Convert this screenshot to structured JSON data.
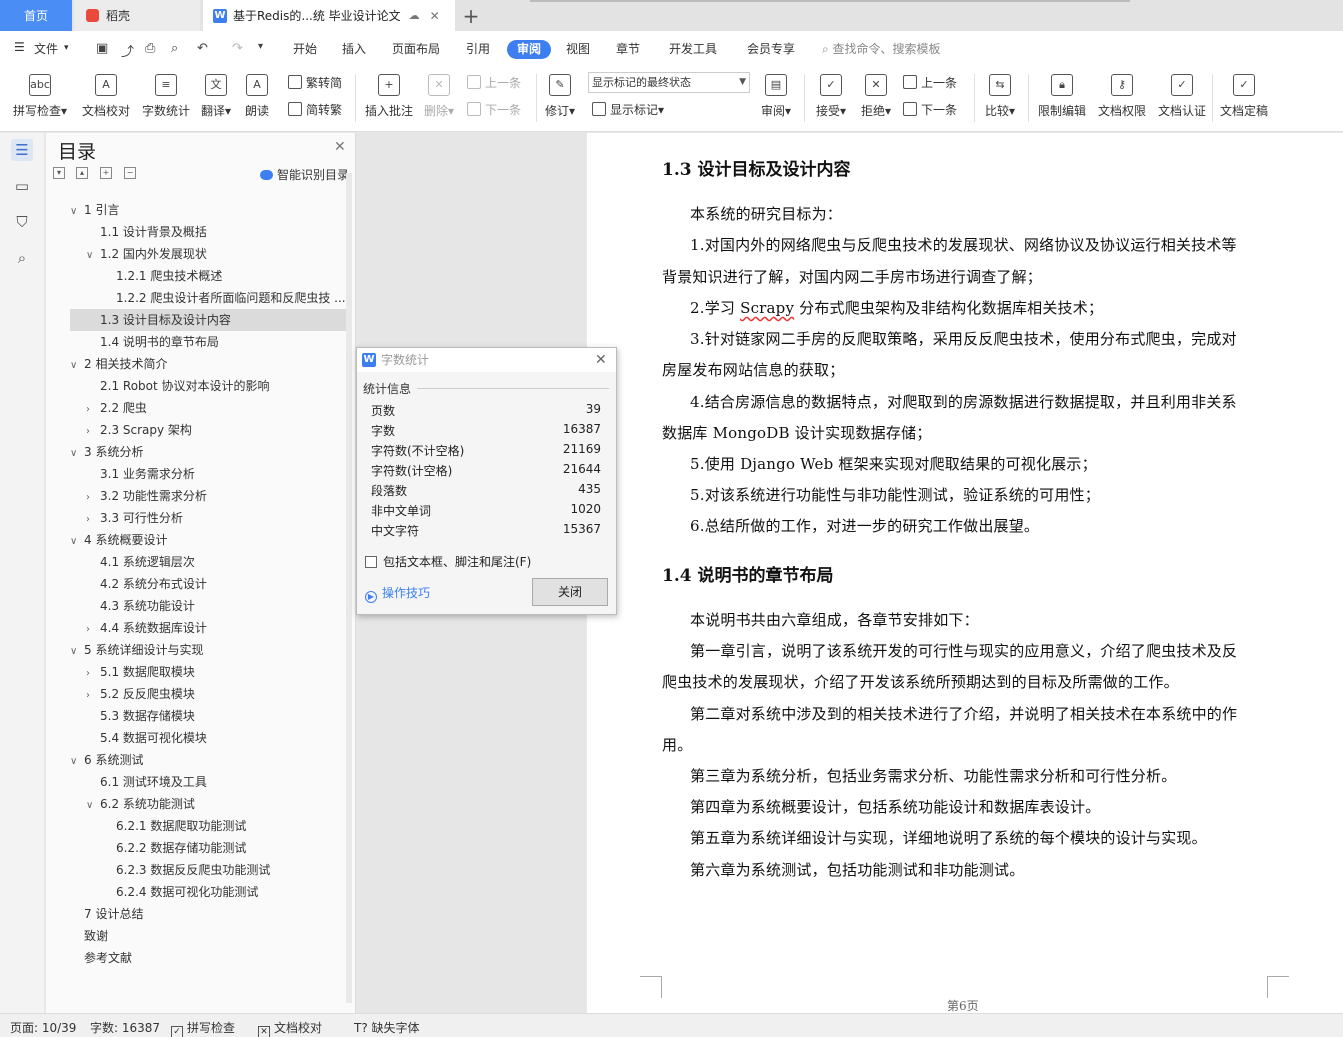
{
  "tabs": {
    "home": "首页",
    "daoke": "稻壳",
    "doc": "基于Redis的...统 毕业设计论文",
    "add": "+"
  },
  "menu": {
    "file": "文件",
    "items": [
      "开始",
      "插入",
      "页面布局",
      "引用",
      "审阅",
      "视图",
      "章节",
      "开发工具",
      "会员专享"
    ],
    "active": "审阅",
    "search": "查找命令、搜索模板"
  },
  "ribbon": {
    "spell": "拼写检查",
    "proof": "文档校对",
    "wordcount": "字数统计",
    "translate": "翻译",
    "read": "朗读",
    "trad": "繁转简",
    "simp": "简转繁",
    "insert_comment": "插入批注",
    "delete": "删除",
    "prev1": "上一条",
    "next1": "下一条",
    "revise": "修订",
    "mark_state": "显示标记的最终状态",
    "show_marks": "显示标记",
    "review": "审阅",
    "accept": "接受",
    "reject": "拒绝",
    "prev2": "上一条",
    "next2": "下一条",
    "compare": "比较",
    "restrict": "限制编辑",
    "perm": "文档权限",
    "cert": "文档认证",
    "final": "文档定稿"
  },
  "toc": {
    "title": "目录",
    "ai_label": "智能识别目录",
    "items": [
      {
        "text": "1  引言",
        "level": 0,
        "arrow": "down"
      },
      {
        "text": "1.1  设计背景及概括",
        "level": 1,
        "arrow": ""
      },
      {
        "text": "1.2  国内外发展现状",
        "level": 1,
        "arrow": "down"
      },
      {
        "text": "1.2.1  爬虫技术概述",
        "level": 2,
        "arrow": ""
      },
      {
        "text": "1.2.2  爬虫设计者所面临问题和反爬虫技 ...",
        "level": 2,
        "arrow": ""
      },
      {
        "text": "1.3  设计目标及设计内容",
        "level": 1,
        "arrow": "",
        "selected": true
      },
      {
        "text": "1.4  说明书的章节布局",
        "level": 1,
        "arrow": ""
      },
      {
        "text": "2  相关技术简介",
        "level": 0,
        "arrow": "down"
      },
      {
        "text": "2.1 Robot 协议对本设计的影响",
        "level": 1,
        "arrow": ""
      },
      {
        "text": "2.2  爬虫",
        "level": 1,
        "arrow": "right"
      },
      {
        "text": "2.3 Scrapy 架构",
        "level": 1,
        "arrow": "right"
      },
      {
        "text": "3  系统分析",
        "level": 0,
        "arrow": "down"
      },
      {
        "text": "3.1  业务需求分析",
        "level": 1,
        "arrow": ""
      },
      {
        "text": "3.2  功能性需求分析",
        "level": 1,
        "arrow": "right"
      },
      {
        "text": "3.3  可行性分析",
        "level": 1,
        "arrow": "right"
      },
      {
        "text": "4  系统概要设计",
        "level": 0,
        "arrow": "down"
      },
      {
        "text": "4.1  系统逻辑层次",
        "level": 1,
        "arrow": ""
      },
      {
        "text": "4.2  系统分布式设计",
        "level": 1,
        "arrow": ""
      },
      {
        "text": "4.3  系统功能设计",
        "level": 1,
        "arrow": ""
      },
      {
        "text": "4.4  系统数据库设计",
        "level": 1,
        "arrow": "right"
      },
      {
        "text": "5  系统详细设计与实现",
        "level": 0,
        "arrow": "down"
      },
      {
        "text": "5.1  数据爬取模块",
        "level": 1,
        "arrow": "right"
      },
      {
        "text": "5.2  反反爬虫模块",
        "level": 1,
        "arrow": "right"
      },
      {
        "text": "5.3  数据存储模块",
        "level": 1,
        "arrow": ""
      },
      {
        "text": "5.4  数据可视化模块",
        "level": 1,
        "arrow": ""
      },
      {
        "text": "6  系统测试",
        "level": 0,
        "arrow": "down"
      },
      {
        "text": "6.1  测试环境及工具",
        "level": 1,
        "arrow": ""
      },
      {
        "text": "6.2  系统功能测试",
        "level": 1,
        "arrow": "down"
      },
      {
        "text": "6.2.1  数据爬取功能测试",
        "level": 2,
        "arrow": ""
      },
      {
        "text": "6.2.2  数据存储功能测试",
        "level": 2,
        "arrow": ""
      },
      {
        "text": "6.2.3  数据反反爬虫功能测试",
        "level": 2,
        "arrow": ""
      },
      {
        "text": "6.2.4  数据可视化功能测试",
        "level": 2,
        "arrow": ""
      },
      {
        "text": "7  设计总结",
        "level": 0,
        "arrow": ""
      },
      {
        "text": "致谢",
        "level": 0,
        "arrow": ""
      },
      {
        "text": "参考文献",
        "level": 0,
        "arrow": ""
      }
    ]
  },
  "dialog": {
    "title": "字数统计",
    "section": "统计信息",
    "stats": [
      {
        "label": "页数",
        "value": "39"
      },
      {
        "label": "字数",
        "value": "16387"
      },
      {
        "label": "字符数(不计空格)",
        "value": "21169"
      },
      {
        "label": "字符数(计空格)",
        "value": "21644"
      },
      {
        "label": "段落数",
        "value": "435"
      },
      {
        "label": "非中文单词",
        "value": "1020"
      },
      {
        "label": "中文字符",
        "value": "15367"
      }
    ],
    "checkbox": "包括文本框、脚注和尾注(F)",
    "tips": "操作技巧",
    "close": "关闭"
  },
  "doc": {
    "h1": "1.3  设计目标及设计内容",
    "p1": "本系统的研究目标为：",
    "p2a": "1.对国内外的网络爬虫与反爬虫技术的发展现状、网络协议及协议运行相关技术等",
    "p2b": "背景知识进行了解，对国内网二手房市场进行调查了解；",
    "p3_pre": "2.学习 ",
    "p3_word": "Scrapy",
    "p3_post": " 分布式爬虫架构及非结构化数据库相关技术；",
    "p4a": "3.针对链家网二手房的反爬取策略，采用反反爬虫技术，使用分布式爬虫，完成对",
    "p4b": "房屋发布网站信息的获取；",
    "p5a": "4.结合房源信息的数据特点，对爬取到的房源数据进行数据提取，并且利用非关系",
    "p5b": "数据库 MongoDB 设计实现数据存储；",
    "p6": "5.使用 Django Web 框架来实现对爬取结果的可视化展示；",
    "p7": "5.对该系统进行功能性与非功能性测试，验证系统的可用性；",
    "p8": "6.总结所做的工作，对进一步的研究工作做出展望。",
    "h2": "1.4  说明书的章节布局",
    "q1": "本说明书共由六章组成，各章节安排如下：",
    "q2a": "第一章引言，说明了该系统开发的可行性与现实的应用意义，介绍了爬虫技术及反",
    "q2b": "爬虫技术的发展现状，介绍了开发该系统所预期达到的目标及所需做的工作。",
    "q3a": "第二章对系统中涉及到的相关技术进行了介绍，并说明了相关技术在本系统中的作",
    "q3b": "用。",
    "q4": "第三章为系统分析，包括业务需求分析、功能性需求分析和可行性分析。",
    "q5": "第四章为系统概要设计，包括系统功能设计和数据库表设计。",
    "q6": "第五章为系统详细设计与实现，详细地说明了系统的每个模块的设计与实现。",
    "q7": "第六章为系统测试，包括功能测试和非功能测试。",
    "pagenum": "第6页"
  },
  "status": {
    "page": "页面: 10/39",
    "words": "字数: 16387",
    "spell": "拼写检查",
    "proof": "文档校对",
    "font": "缺失字体"
  }
}
